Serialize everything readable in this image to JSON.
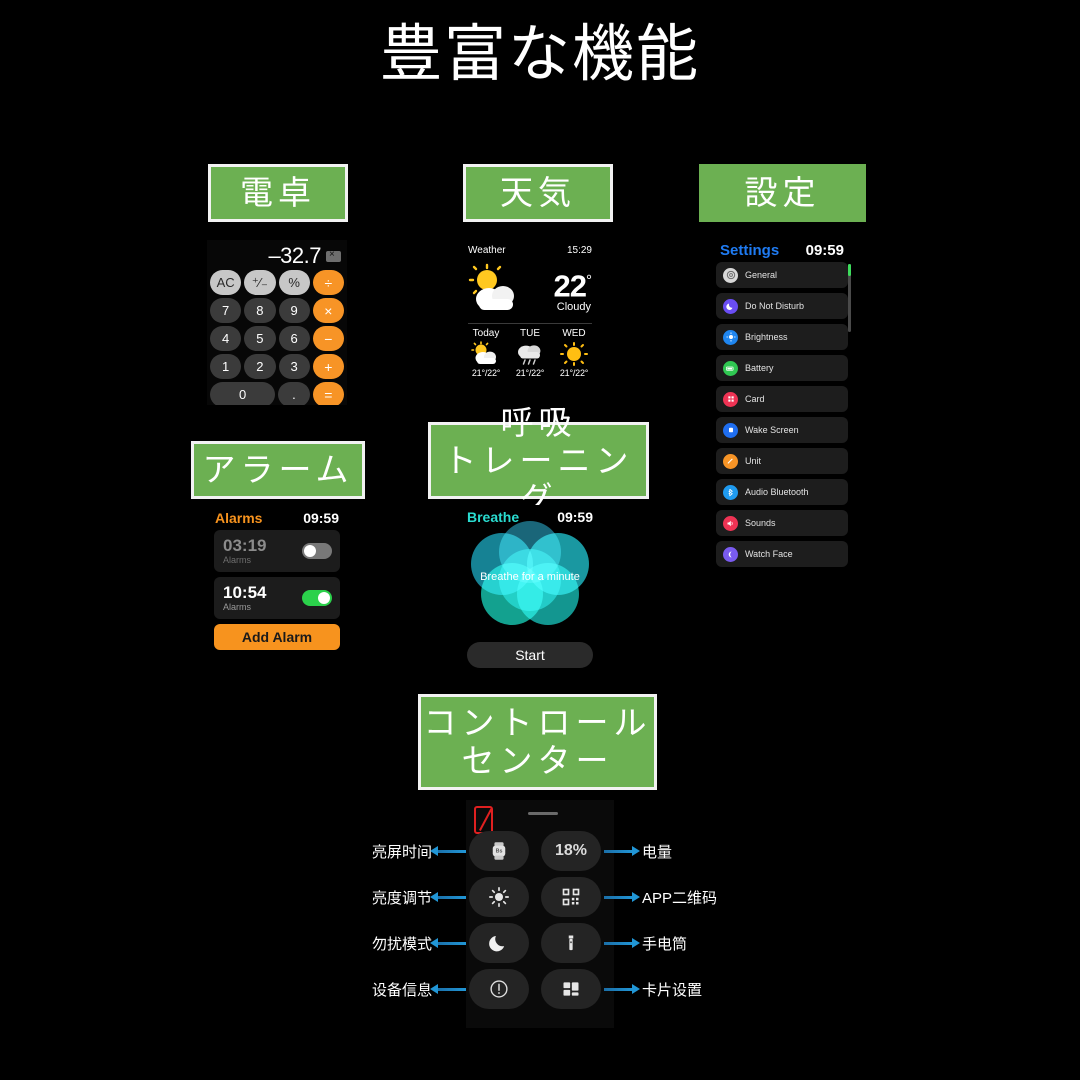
{
  "page": {
    "title": "豊富な機能"
  },
  "sections": {
    "calculator": {
      "caption": "電卓"
    },
    "weather": {
      "caption": "天気"
    },
    "settings": {
      "caption": "設定"
    },
    "alarm": {
      "caption": "アラーム"
    },
    "breathe": {
      "caption_line1": "呼吸",
      "caption_line2": "トレーニング"
    },
    "control_center": {
      "caption_line1": "コントロール",
      "caption_line2": "センター"
    }
  },
  "calculator": {
    "display_value": "–32.7",
    "delete_icon": "backspace-icon",
    "keys": [
      [
        "AC",
        "⁺∕₋",
        "%",
        "÷"
      ],
      [
        "7",
        "8",
        "9",
        "×"
      ],
      [
        "4",
        "5",
        "6",
        "−"
      ],
      [
        "1",
        "2",
        "3",
        "+"
      ],
      [
        "0",
        ".",
        "="
      ]
    ]
  },
  "weather": {
    "title": "Weather",
    "time": "15:29",
    "temperature": "22",
    "degree": "°",
    "condition": "Cloudy",
    "current_icon": "sun-behind-cloud-icon",
    "forecast": [
      {
        "day": "Today",
        "icon": "sun-behind-cloud-icon",
        "temps": "21°/22°"
      },
      {
        "day": "TUE",
        "icon": "cloud-with-rain-icon",
        "temps": "21°/22°"
      },
      {
        "day": "WED",
        "icon": "sun-icon",
        "temps": "21°/22°"
      }
    ]
  },
  "settings": {
    "title": "Settings",
    "time": "09:59",
    "accent": "#1f7bf2",
    "scrollbar_color": "#3ddc5c",
    "items": [
      {
        "label": "General",
        "icon": "gear-icon",
        "color": "#d8d8d8"
      },
      {
        "label": "Do Not Disturb",
        "icon": "moon-icon",
        "color": "#6a4df5"
      },
      {
        "label": "Brightness",
        "icon": "brightness-icon",
        "color": "#1f86f0"
      },
      {
        "label": "Battery",
        "icon": "battery-icon",
        "color": "#30c752"
      },
      {
        "label": "Card",
        "icon": "card-icon",
        "color": "#ef3354"
      },
      {
        "label": "Wake Screen",
        "icon": "square-icon",
        "color": "#1f6ef0"
      },
      {
        "label": "Unit",
        "icon": "pen-icon",
        "color": "#f79426"
      },
      {
        "label": "Audio Bluetooth",
        "icon": "bluetooth-icon",
        "color": "#1f9bf0"
      },
      {
        "label": "Sounds",
        "icon": "speaker-icon",
        "color": "#ef3354"
      },
      {
        "label": "Watch Face",
        "icon": "watchface-icon",
        "color": "#7a5bf0"
      }
    ]
  },
  "alarms": {
    "title": "Alarms",
    "time": "09:59",
    "accent": "#f7931e",
    "rows": [
      {
        "time": "03:19",
        "sub": "Alarms",
        "enabled": false
      },
      {
        "time": "10:54",
        "sub": "Alarms",
        "enabled": true
      }
    ],
    "add_button": "Add Alarm"
  },
  "breathe": {
    "title": "Breathe",
    "time": "09:59",
    "caption": "Breathe for a minute",
    "start_button": "Start",
    "accent": "#2adcd0",
    "petal_colors": [
      "#1f7c94",
      "#1a9fb5",
      "#17b7b0",
      "#17c4ae",
      "#1fb9c4",
      "#149c9c"
    ]
  },
  "control_center": {
    "battery_icon": "low-battery-icon",
    "rows": [
      {
        "left_label": "亮屏时间",
        "left_icon": "watch-icon",
        "left_tile_text": "Bs",
        "right_label": "电量",
        "right_icon": "battery-percent",
        "right_tile_text": "18%"
      },
      {
        "left_label": "亮度调节",
        "left_icon": "brightness-icon",
        "left_tile_text": "",
        "right_label": "APP二维码",
        "right_icon": "qrcode-icon",
        "right_tile_text": ""
      },
      {
        "left_label": "勿扰模式",
        "left_icon": "moon-icon",
        "left_tile_text": "",
        "right_label": "手电筒",
        "right_icon": "flashlight-icon",
        "right_tile_text": ""
      },
      {
        "left_label": "设备信息",
        "left_icon": "info-icon",
        "left_tile_text": "",
        "right_label": "卡片设置",
        "right_icon": "cards-grid-icon",
        "right_tile_text": ""
      }
    ]
  }
}
